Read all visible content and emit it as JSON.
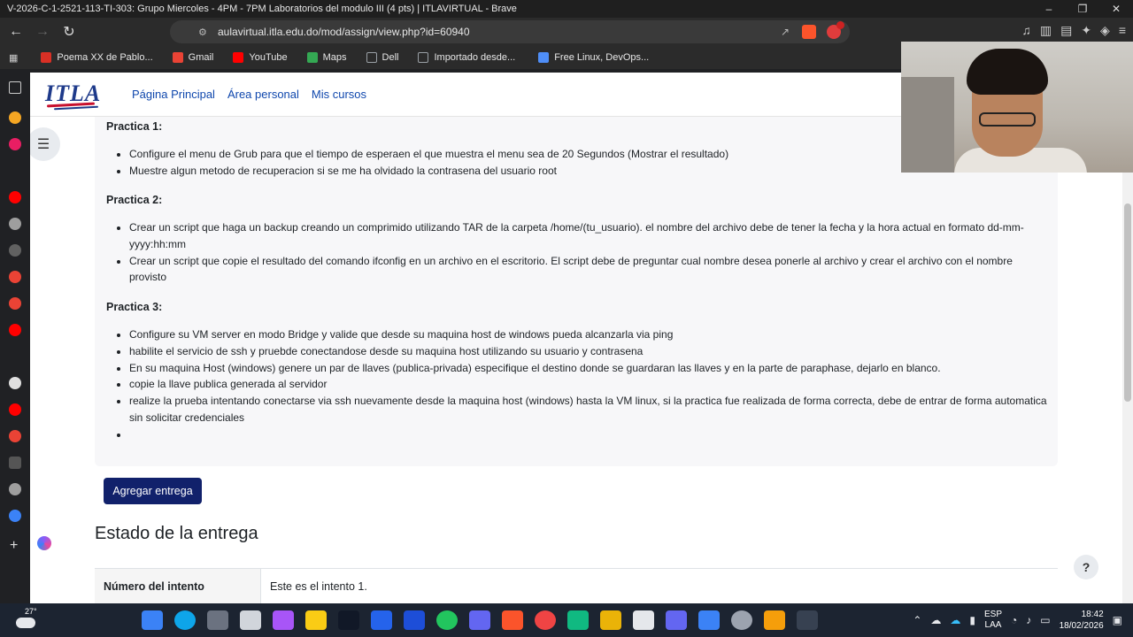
{
  "window": {
    "title": "V-2026-C-1-2521-113-TI-303: Grupo Miercoles - 4PM - 7PM Laboratorios del modulo III (4 pts) | ITLAVIRTUAL - Brave",
    "minimize": "–",
    "maximize": "❐",
    "close": "✕"
  },
  "browser": {
    "url": "aulavirtual.itla.edu.do/mod/assign/view.php?id=60940",
    "bookmarks": [
      {
        "label": "Poema XX de Pablo...",
        "icon": "bookmark-red-icon",
        "color": "#d93025"
      },
      {
        "label": "Gmail",
        "icon": "gmail-icon",
        "color": "#ea4335"
      },
      {
        "label": "YouTube",
        "icon": "youtube-icon",
        "color": "#ff0000"
      },
      {
        "label": "Maps",
        "icon": "maps-icon",
        "color": "#34a853"
      },
      {
        "label": "Dell",
        "icon": "folder-icon",
        "color": "#9aa0a6"
      },
      {
        "label": "Importado desde...",
        "icon": "folder-icon",
        "color": "#9aa0a6"
      },
      {
        "label": "Free Linux, DevOps...",
        "icon": "flask-icon",
        "color": "#4f8ef7"
      }
    ]
  },
  "site": {
    "logo_text": "ITLA",
    "nav": [
      "Página Principal",
      "Área personal",
      "Mis cursos"
    ]
  },
  "assignment": {
    "sections": [
      {
        "heading": "Practica 1:",
        "items": [
          "Configure el menu de Grub para que el tiempo de esperaen el que muestra el menu sea de 20 Segundos (Mostrar el resultado)",
          "Muestre algun metodo de recuperacion si se me ha olvidado la contrasena del usuario root"
        ]
      },
      {
        "heading": "Practica 2:",
        "items": [
          "Crear un script que haga un backup creando un comprimido utilizando TAR de la carpeta /home/(tu_usuario). el nombre del archivo debe de tener la fecha y la hora actual en formato dd-mm-yyyy:hh:mm",
          "Crear un script que copie el resultado del comando ifconfig en un archivo en el escritorio. El script debe de preguntar cual nombre desea ponerle al archivo y crear el archivo con el nombre provisto"
        ]
      },
      {
        "heading": "Practica 3:",
        "items": [
          "Configure su VM server en modo Bridge y valide que desde su maquina host de windows pueda alcanzarla via ping",
          "habilite el servicio de ssh y pruebde conectandose desde su maquina host utilizando su usuario y contrasena",
          "En su maquina Host (windows) genere un par de llaves (publica-privada) especifique el destino donde se guardaran las llaves y en la parte de paraphase, dejarlo en blanco.",
          "copie la llave publica generada al servidor",
          "realize la prueba intentando conectarse via ssh nuevamente desde la maquina host (windows) hasta la VM linux, si la practica fue realizada de forma correcta, debe de entrar de forma automatica sin solicitar credenciales",
          ""
        ]
      }
    ],
    "submit_button": "Agregar entrega",
    "status_title": "Estado de la entrega",
    "status_rows": [
      {
        "label": "Número del intento",
        "value": "Este es el intento 1."
      }
    ]
  },
  "help": "?",
  "taskbar": {
    "temperature": "27°",
    "language": "ESP",
    "layout": "LAA",
    "time": "18:42",
    "date": "18/02/2026"
  }
}
